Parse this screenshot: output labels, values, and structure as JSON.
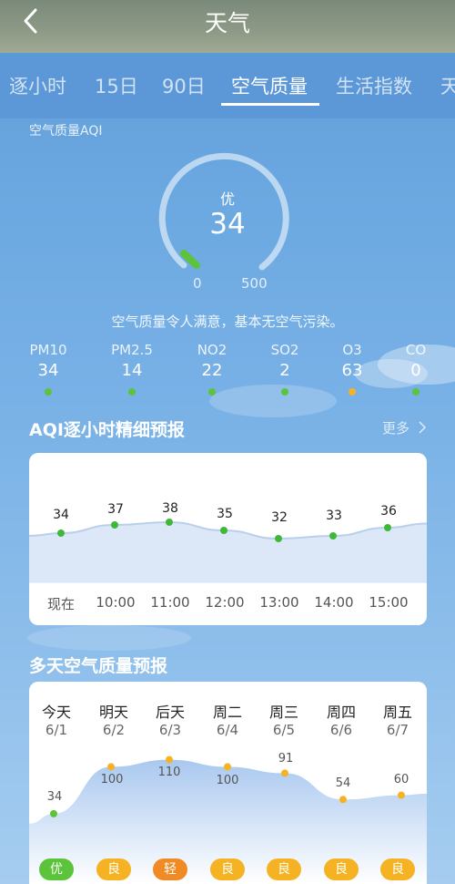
{
  "header": {
    "title": "天气",
    "back_icon": "chevron-left-icon"
  },
  "tabs": [
    {
      "label": "逐小时"
    },
    {
      "label": "15日"
    },
    {
      "label": "90日"
    },
    {
      "label": "空气质量",
      "active": true
    },
    {
      "label": "生活指数"
    },
    {
      "label": "天"
    }
  ],
  "aqi": {
    "section_label": "空气质量AQI",
    "category": "优",
    "value": "34",
    "scale_min": "0",
    "scale_max": "500",
    "description": "空气质量令人满意，基本无空气污染。"
  },
  "pollutants": [
    {
      "name": "PM10",
      "value": "34",
      "color": "#5bc43a"
    },
    {
      "name": "PM2.5",
      "value": "14",
      "color": "#5bc43a"
    },
    {
      "name": "NO2",
      "value": "22",
      "color": "#5bc43a"
    },
    {
      "name": "SO2",
      "value": "2",
      "color": "#5bc43a"
    },
    {
      "name": "O3",
      "value": "63",
      "color": "#f5b324"
    },
    {
      "name": "CO",
      "value": "0",
      "color": "#5bc43a"
    }
  ],
  "hourly": {
    "title": "AQI逐小时精细预报",
    "more_label": "更多",
    "points": [
      {
        "time": "现在",
        "value": "34"
      },
      {
        "time": "10:00",
        "value": "37"
      },
      {
        "time": "11:00",
        "value": "38"
      },
      {
        "time": "12:00",
        "value": "35"
      },
      {
        "time": "13:00",
        "value": "32"
      },
      {
        "time": "14:00",
        "value": "33"
      },
      {
        "time": "15:00",
        "value": "36"
      }
    ]
  },
  "daily": {
    "title": "多天空气质量预报",
    "days": [
      {
        "name": "今天",
        "date": "6/1",
        "value": "34",
        "level": "优",
        "color": "#5bc43a"
      },
      {
        "name": "明天",
        "date": "6/2",
        "value": "100",
        "level": "良",
        "color": "#f5b324"
      },
      {
        "name": "后天",
        "date": "6/3",
        "value": "110",
        "level": "轻",
        "color": "#f08a24"
      },
      {
        "name": "周二",
        "date": "6/4",
        "value": "100",
        "level": "良",
        "color": "#f5b324"
      },
      {
        "name": "周三",
        "date": "6/5",
        "value": "91",
        "level": "良",
        "color": "#f5b324"
      },
      {
        "name": "周四",
        "date": "6/6",
        "value": "54",
        "level": "良",
        "color": "#f5b324"
      },
      {
        "name": "周五",
        "date": "6/7",
        "value": "60",
        "level": "良",
        "color": "#f5b324"
      }
    ]
  }
}
